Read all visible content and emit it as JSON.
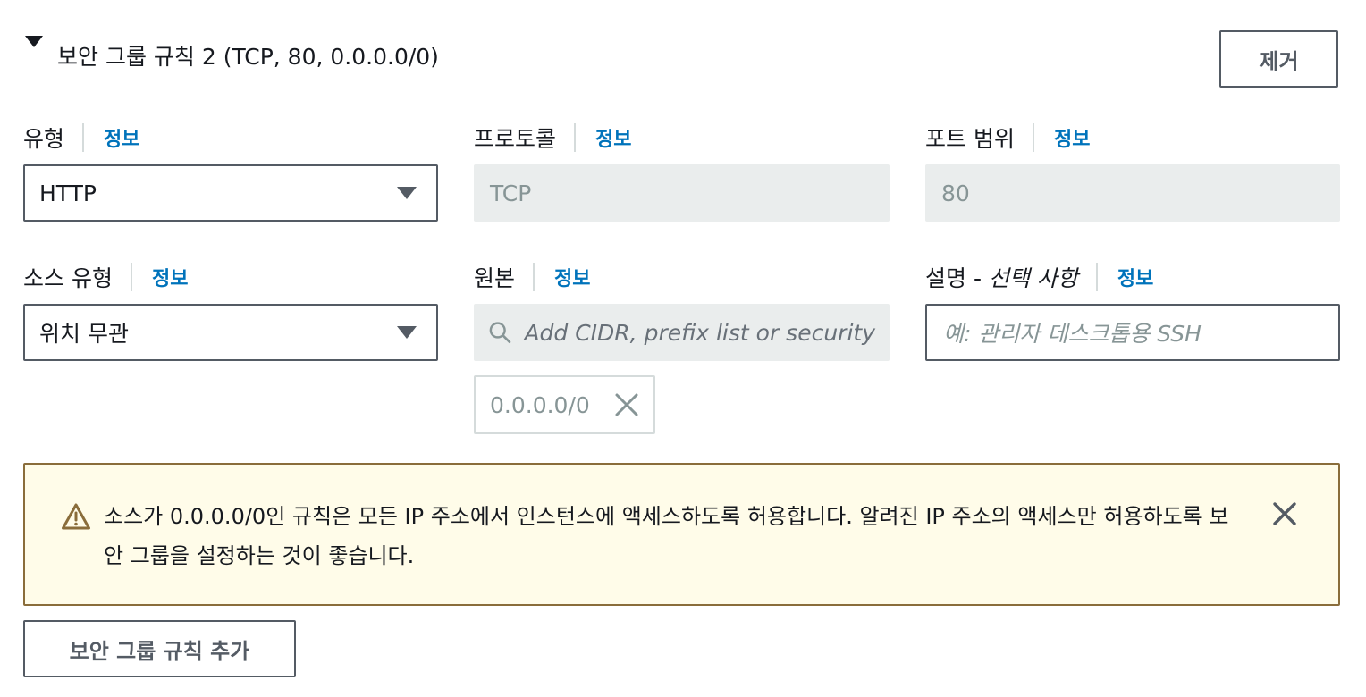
{
  "rule": {
    "title": "보안 그룹 규칙 2 (TCP, 80, 0.0.0.0/0)",
    "remove_label": "제거"
  },
  "info_label": "정보",
  "type": {
    "label": "유형",
    "value": "HTTP"
  },
  "protocol": {
    "label": "프로토콜",
    "value": "TCP"
  },
  "port_range": {
    "label": "포트 범위",
    "value": "80"
  },
  "source_type": {
    "label": "소스 유형",
    "value": "위치 무관"
  },
  "source": {
    "label": "원본",
    "placeholder": "Add CIDR, prefix list or security",
    "tokens": [
      "0.0.0.0/0"
    ]
  },
  "description": {
    "label": "설명 -",
    "label_optional": "선택 사항",
    "placeholder": "예: 관리자 데스크톱용 SSH"
  },
  "alert": {
    "message": "소스가 0.0.0.0/0인 규칙은 모든 IP 주소에서 인스턴스에 액세스하도록 허용합니다. 알려진 IP 주소의 액세스만 허용하도록 보안 그룹을 설정하는 것이 좋습니다."
  },
  "add_rule_label": "보안 그룹 규칙 추가",
  "colors": {
    "link": "#0073bb",
    "alert_bg": "#fffce9",
    "alert_border": "#8a6d3b",
    "disabled_bg": "#eaeded"
  }
}
